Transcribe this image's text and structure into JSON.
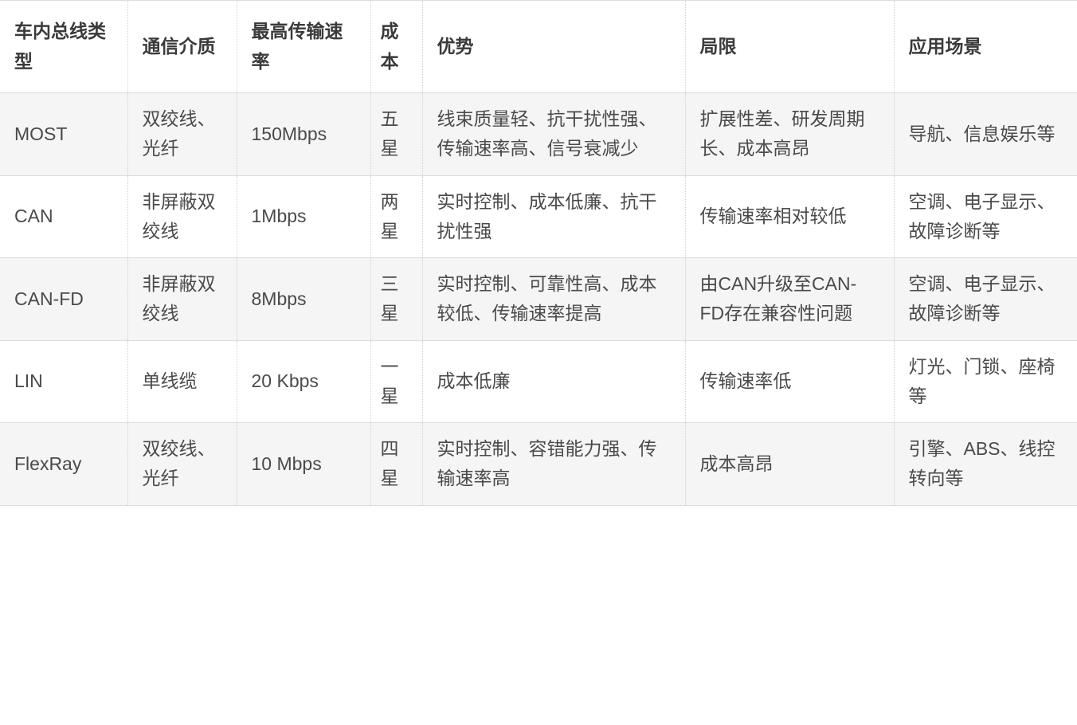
{
  "table": {
    "headers": [
      "车内总线类型",
      "通信介质",
      "最高传输速率",
      "成本",
      "优势",
      "局限",
      "应用场景"
    ],
    "rows": [
      {
        "type": "MOST",
        "medium": "双绞线、光纤",
        "rate": "150Mbps",
        "cost": "五星",
        "advantage": "线束质量轻、抗干扰性强、传输速率高、信号衰减少",
        "limitation": "扩展性差、研发周期长、成本高昂",
        "scenario": "导航、信息娱乐等"
      },
      {
        "type": "CAN",
        "medium": "非屏蔽双绞线",
        "rate": "1Mbps",
        "cost": "两星",
        "advantage": "实时控制、成本低廉、抗干扰性强",
        "limitation": "传输速率相对较低",
        "scenario": "空调、电子显示、故障诊断等"
      },
      {
        "type": "CAN-FD",
        "medium": "非屏蔽双绞线",
        "rate": "8Mbps",
        "cost": "三星",
        "advantage": "实时控制、可靠性高、成本较低、传输速率提高",
        "limitation": "由CAN升级至CAN-FD存在兼容性问题",
        "scenario": "空调、电子显示、故障诊断等"
      },
      {
        "type": "LIN",
        "medium": "单线缆",
        "rate": "20 Kbps",
        "cost": "一星",
        "advantage": "成本低廉",
        "limitation": "传输速率低",
        "scenario": "灯光、门锁、座椅等"
      },
      {
        "type": "FlexRay",
        "medium": "双绞线、光纤",
        "rate": "10 Mbps",
        "cost": "四星",
        "advantage": "实时控制、容错能力强、传输速率高",
        "limitation": "成本高昂",
        "scenario": "引擎、ABS、线控转向等"
      }
    ]
  },
  "colors": {
    "row_stripe": "#f5f5f5",
    "row_plain": "#ffffff",
    "border_solid": "#dddddd",
    "border_dotted": "#d0d0d0",
    "text": "#4a4a4a",
    "header_text": "#3a3a3a"
  }
}
